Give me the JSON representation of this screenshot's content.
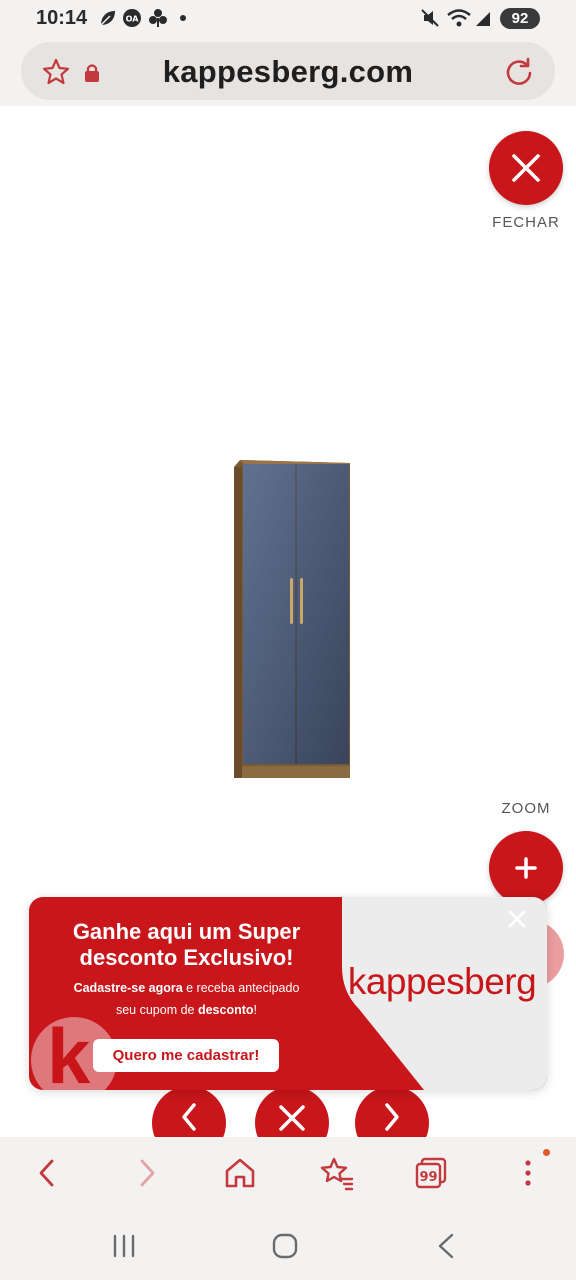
{
  "status_bar": {
    "time": "10:14",
    "battery": "92",
    "icons": [
      "leaf-icon",
      "oa-icon",
      "pinwheel-icon",
      "dot-icon",
      "mute-icon",
      "wifi-icon",
      "signal-icon"
    ]
  },
  "browser": {
    "url": "kappesberg.com",
    "left_icons": [
      "star-icon",
      "lock-icon"
    ],
    "right_icon": "reload-icon"
  },
  "viewer": {
    "close_label": "FECHAR",
    "zoom_label": "ZOOM"
  },
  "promo": {
    "title_line1": "Ganhe aqui um Super",
    "title_line2": "desconto Exclusivo!",
    "sub_bold1": "Cadastre-se agora",
    "sub_text1": " e receba antecipado",
    "sub_text2": "seu cupom de ",
    "sub_bold2": "desconto",
    "sub_text3": "!",
    "cta": "Quero me cadastrar!",
    "brand": "kappesberg",
    "logo_letter": "k"
  },
  "toolbar": {
    "icons": [
      "back-icon",
      "forward-icon",
      "home-icon",
      "bookmarks-icon",
      "tabs-icon",
      "menu-icon"
    ],
    "tabs_count": "99"
  },
  "colors": {
    "brand_red": "#c8161b",
    "chrome_bg": "#f4f2f1"
  }
}
